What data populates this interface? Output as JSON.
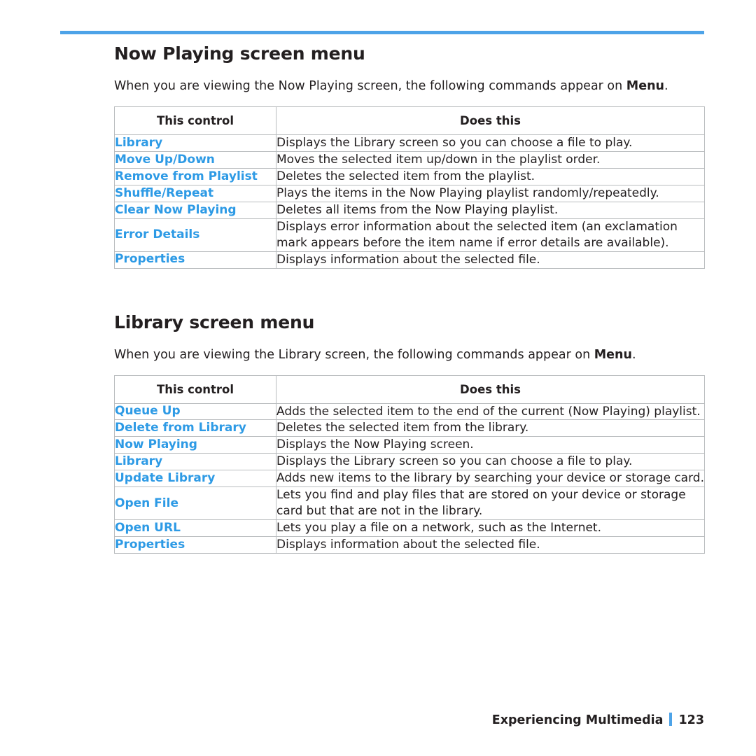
{
  "page": {
    "accent_color": "#4da3e8",
    "link_color": "#2d9ae5",
    "text_color": "#231f20"
  },
  "sections": [
    {
      "title": "Now Playing screen menu",
      "intro_before": "When you are viewing the Now Playing screen, the following commands appear on ",
      "intro_bold": "Menu",
      "intro_after": ".",
      "columns": [
        "This control",
        "Does this"
      ],
      "rows": [
        {
          "control": "Library",
          "desc": "Displays the Library screen so you can choose a file to play."
        },
        {
          "control": "Move Up/Down",
          "desc": "Moves the selected item up/down in the playlist order."
        },
        {
          "control": "Remove from Playlist",
          "desc": "Deletes the selected item from the playlist."
        },
        {
          "control": "Shuffle/Repeat",
          "desc": "Plays the items in the Now Playing playlist randomly/repeatedly."
        },
        {
          "control": "Clear Now Playing",
          "desc": "Deletes all items from the Now Playing playlist."
        },
        {
          "control": "Error Details",
          "desc": "Displays error information about the selected item (an exclamation mark appears before the item name if error details are available)."
        },
        {
          "control": "Properties",
          "desc": "Displays information about the selected file."
        }
      ]
    },
    {
      "title": "Library screen menu",
      "intro_before": "When you are viewing the Library screen, the following commands appear on ",
      "intro_bold": "Menu",
      "intro_after": ".",
      "columns": [
        "This control",
        "Does this"
      ],
      "rows": [
        {
          "control": "Queue Up",
          "desc": "Adds the selected item to the end of the current (Now Playing) playlist."
        },
        {
          "control": "Delete from Library",
          "desc": "Deletes the selected item from the library."
        },
        {
          "control": "Now Playing",
          "desc": "Displays the Now Playing screen."
        },
        {
          "control": "Library",
          "desc": "Displays the Library screen so you can choose a file to play."
        },
        {
          "control": "Update Library",
          "desc": "Adds new items to the library by searching your device or storage card."
        },
        {
          "control": "Open File",
          "desc": "Lets you find and play files that are stored on your device or storage card but that are not in the library."
        },
        {
          "control": "Open URL",
          "desc": "Lets you play a file on a network, such as the Internet."
        },
        {
          "control": "Properties",
          "desc": "Displays information about the selected file."
        }
      ]
    }
  ],
  "footer": {
    "chapter": "Experiencing Multimedia",
    "page_number": "123"
  }
}
